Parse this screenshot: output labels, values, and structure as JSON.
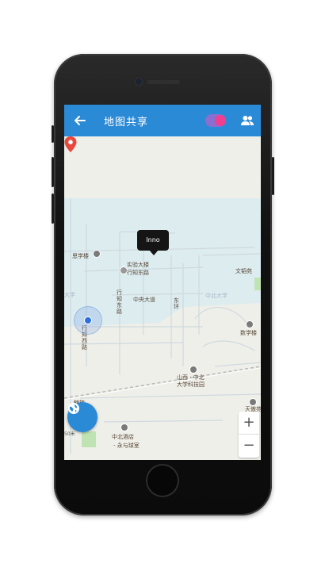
{
  "appbar": {
    "title": "地图共享",
    "back_icon": "arrow-back-icon",
    "toggle_on": true,
    "group_icon": "group-icon"
  },
  "map": {
    "marker_label": "Inno",
    "labels": {
      "library": "思学楼",
      "lab_building": "实验大楼",
      "xingzhi_east": "行知东路",
      "central_ave": "中央大道",
      "east_ring": "东环",
      "wenying": "文韬苑",
      "zhongbei_university": "中北大学",
      "daxue_left": "大学",
      "xingzhi_west": "行知西路",
      "math_building": "数学楼",
      "shanxi_park": "山西 · 中北\n大学科技园",
      "meiyuan": "魅族",
      "zhongbei_hotel": "中北酒店",
      "banquet_hall": "- 永与球室",
      "tianyiyuan": "天傲苑"
    },
    "scale_text": "50米",
    "zoom_in": "+",
    "zoom_out": "−"
  },
  "fab": {
    "icon": "globe-icon"
  },
  "colors": {
    "appbar": "#2b8ad6",
    "water": "#dcecef",
    "road": "#ffffff",
    "marker": "#e8483d"
  }
}
